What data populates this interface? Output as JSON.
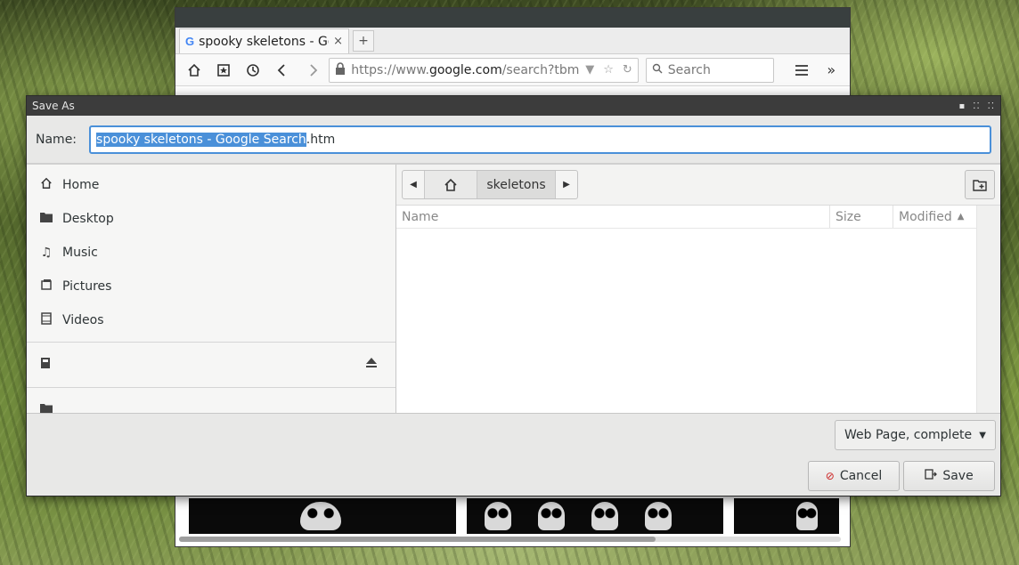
{
  "browser": {
    "tab_title": "spooky skeletons - Go",
    "tab_favicon": "G",
    "tab_close": "×",
    "new_tab": "+",
    "url_prefix": "https://www.",
    "url_domain": "google.com",
    "url_rest": "/search?tbm=",
    "search_placeholder": "Search",
    "icons": {
      "home": "home-icon",
      "bookmarks": "bookmarks-icon",
      "history": "history-icon",
      "back": "back-icon",
      "forward": "forward-icon",
      "lock": "lock-icon",
      "menu": "menu-icon",
      "overflow": "overflow-icon"
    }
  },
  "dialog": {
    "title": "Save As",
    "name_label": "Name:",
    "name_selected": "spooky skeletons - Google Search",
    "name_ext": ".htm",
    "places": [
      {
        "label": "Home",
        "icon": "home-icon"
      },
      {
        "label": "Desktop",
        "icon": "folder-icon"
      },
      {
        "label": "Music",
        "icon": "music-icon"
      },
      {
        "label": "Pictures",
        "icon": "pictures-icon"
      },
      {
        "label": "Videos",
        "icon": "videos-icon"
      }
    ],
    "path": {
      "current_folder": "skeletons"
    },
    "columns": {
      "name": "Name",
      "size": "Size",
      "modified": "Modified"
    },
    "file_type": "Web Page, complete",
    "cancel_label": "Cancel",
    "save_label": "Save",
    "accent_color": "#4a90d9"
  }
}
